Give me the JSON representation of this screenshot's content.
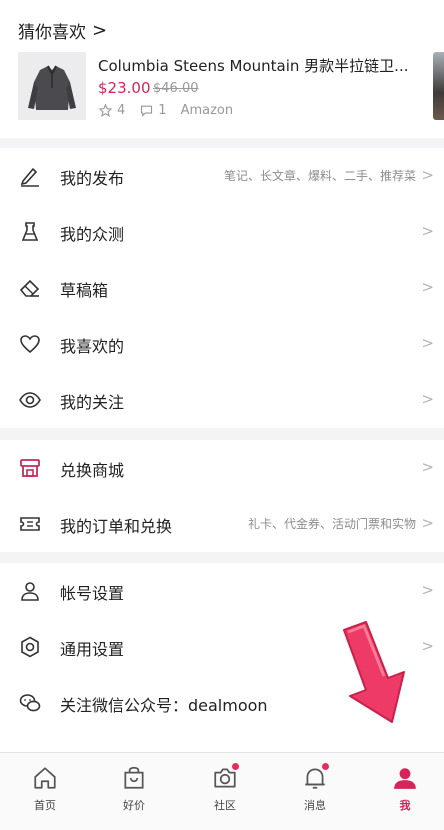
{
  "recommend": {
    "title": "猜你喜欢",
    "product": {
      "name": "Columbia Steens Mountain 男款半拉链卫...",
      "price": "$23.00",
      "original_price": "$46.00",
      "likes": "4",
      "comments": "1",
      "store": "Amazon"
    }
  },
  "menu_group_1": [
    {
      "label": "我的发布",
      "hint": "笔记、长文章、爆料、二手、推荐菜",
      "icon": "pen-icon"
    },
    {
      "label": "我的众测",
      "hint": "",
      "icon": "flask-icon"
    },
    {
      "label": "草稿箱",
      "hint": "",
      "icon": "eraser-icon"
    },
    {
      "label": "我喜欢的",
      "hint": "",
      "icon": "heart-icon"
    },
    {
      "label": "我的关注",
      "hint": "",
      "icon": "eye-icon"
    }
  ],
  "menu_group_2": [
    {
      "label": "兑换商城",
      "hint": "",
      "icon": "shop-icon"
    },
    {
      "label": "我的订单和兑换",
      "hint": "礼卡、代金券、活动门票和实物",
      "icon": "ticket-icon"
    }
  ],
  "menu_group_3": [
    {
      "label": "帐号设置",
      "hint": "",
      "icon": "user-icon"
    },
    {
      "label": "通用设置",
      "hint": "",
      "icon": "settings-icon"
    },
    {
      "label": "关注微信公众号：dealmoon",
      "hint": "",
      "icon": "wechat-icon"
    }
  ],
  "tabbar": [
    {
      "label": "首页",
      "icon": "home-icon",
      "badge": false,
      "active": false
    },
    {
      "label": "好价",
      "icon": "bag-icon",
      "badge": false,
      "active": false
    },
    {
      "label": "社区",
      "icon": "camera-icon",
      "badge": true,
      "active": false
    },
    {
      "label": "消息",
      "icon": "bell-icon",
      "badge": true,
      "active": false
    },
    {
      "label": "我",
      "icon": "profile-icon",
      "badge": false,
      "active": true
    }
  ],
  "colors": {
    "accent": "#d6245a",
    "background": "#f4f4f6",
    "hint_text": "#8d8d8d",
    "shop_icon": "#c8285a"
  }
}
